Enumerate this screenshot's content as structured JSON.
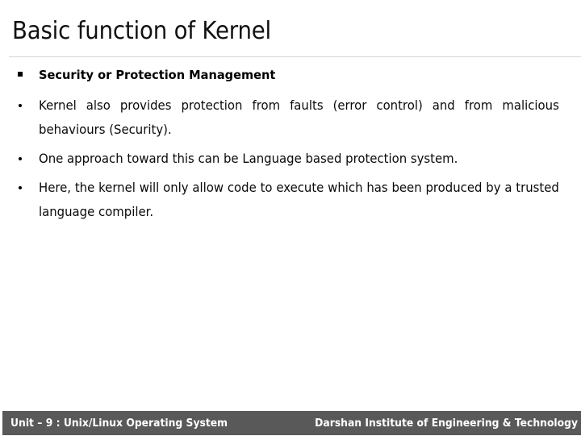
{
  "slide": {
    "title": "Basic function of Kernel",
    "colors": {
      "text": "#000000",
      "divider": "#d5d5d5",
      "footer_background": "#595959",
      "footer_text": "#ffffff",
      "background": "#ffffff"
    },
    "bullets": [
      {
        "level": 1,
        "marker": "square-bullet-icon",
        "bold": true,
        "justified": false,
        "text": "Security or Protection Management"
      },
      {
        "level": 2,
        "marker": "round-bullet-icon",
        "bold": false,
        "justified": true,
        "text": "Kernel also provides protection from faults (error control) and from malicious behaviours (Security)."
      },
      {
        "level": 2,
        "marker": "round-bullet-icon",
        "bold": false,
        "justified": false,
        "text": "One approach toward this can be Language based protection system."
      },
      {
        "level": 2,
        "marker": "round-bullet-icon",
        "bold": false,
        "justified": true,
        "text": "Here, the kernel will only allow code to execute which has been produced by a trusted language compiler."
      }
    ],
    "footer": {
      "left": "Unit – 9 : Unix/Linux Operating System",
      "right": "Darshan Institute of Engineering & Technology"
    }
  }
}
